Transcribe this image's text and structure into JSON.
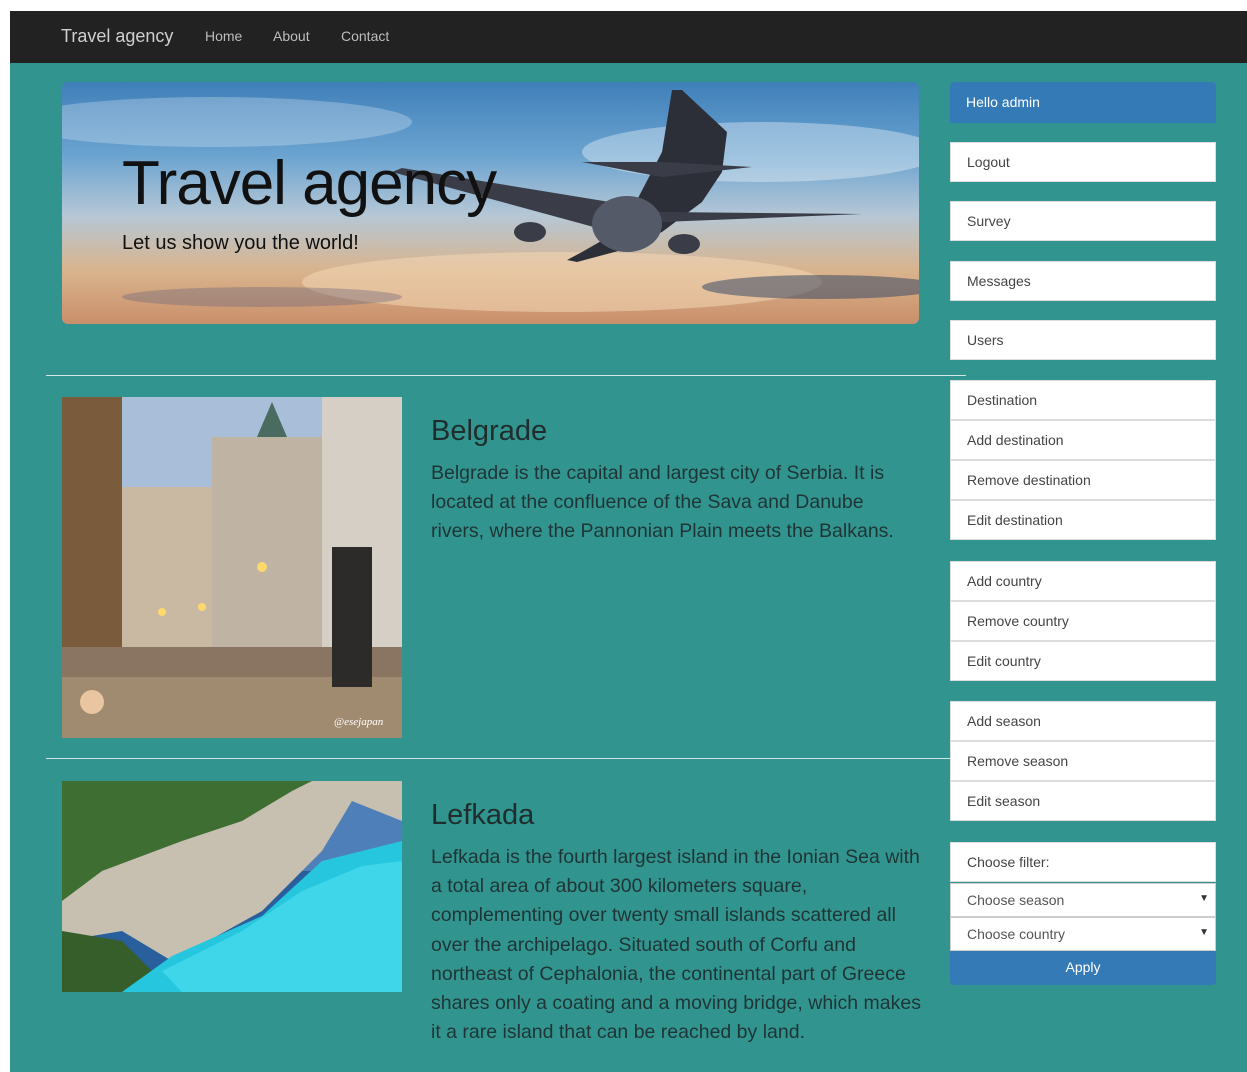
{
  "navbar": {
    "brand": "Travel agency",
    "links": [
      "Home",
      "About",
      "Contact"
    ]
  },
  "hero": {
    "title": "Travel agency",
    "subtitle": "Let us show you the world!"
  },
  "destinations": [
    {
      "name": "Belgrade",
      "description": "Belgrade is the capital and largest city of Serbia. It is located at the confluence of the Sava and Danube rivers, where the Pannonian Plain meets the Balkans.",
      "image_caption": "@esejapan"
    },
    {
      "name": "Lefkada",
      "description": "Lefkada is the fourth largest island in the Ionian Sea with a total area of about 300 kilometers square, complementing over twenty small islands scattered all over the archipelago. Situated south of Corfu and northeast of Cephalonia, the continental part of Greece shares only a coating and a moving bridge, which makes it a rare island that can be reached by land."
    }
  ],
  "sidebar": {
    "greeting": "Hello admin",
    "groups": [
      [
        "Logout"
      ],
      [
        "Survey"
      ],
      [
        "Messages"
      ],
      [
        "Users"
      ],
      [
        "Destination",
        "Add destination",
        "Remove destination",
        "Edit destination"
      ],
      [
        "Add country",
        "Remove country",
        "Edit country"
      ],
      [
        "Add season",
        "Remove season",
        "Edit season"
      ]
    ],
    "filter": {
      "label": "Choose filter:",
      "season_select": "Choose season",
      "country_select": "Choose country",
      "apply": "Apply"
    }
  },
  "colors": {
    "page_bg": "#32948f",
    "navbar_bg": "#222222",
    "primary": "#337ab7"
  }
}
